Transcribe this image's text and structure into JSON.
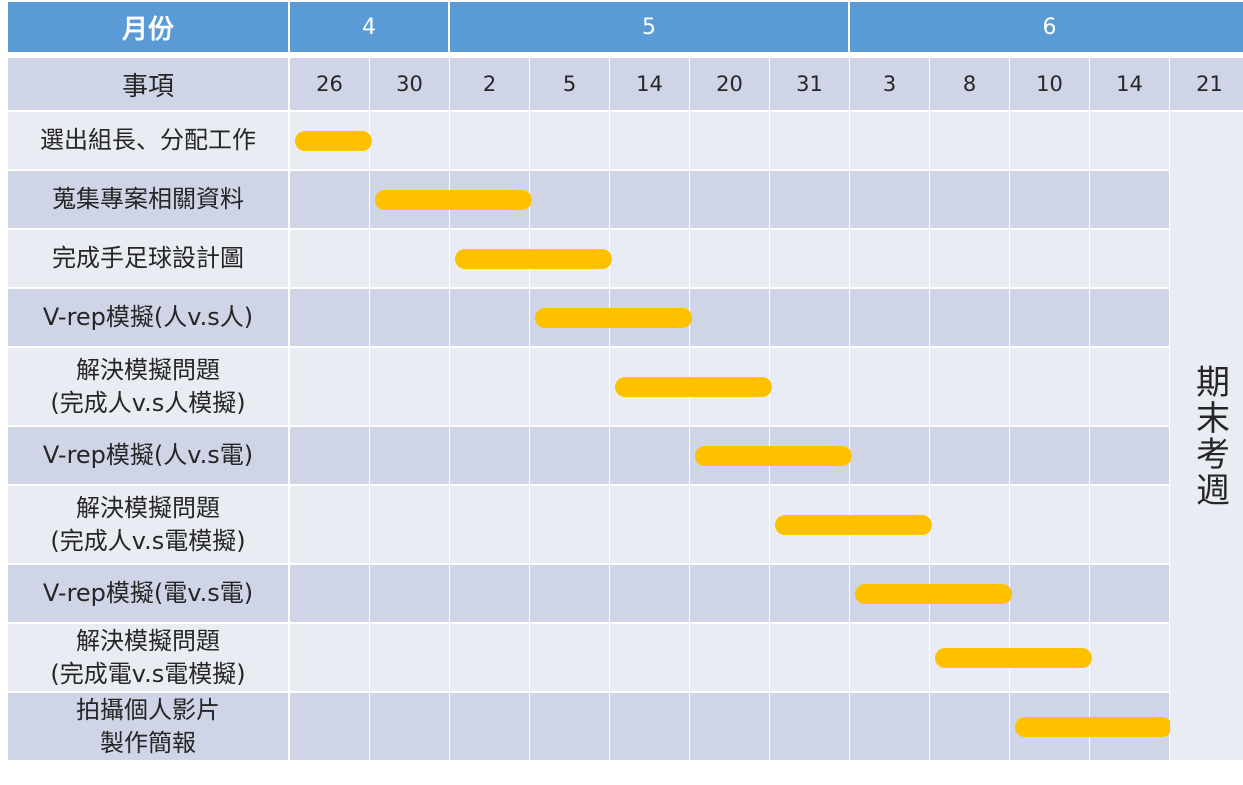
{
  "chart_data": {
    "type": "gantt",
    "header": {
      "month_label": "月份",
      "item_label": "事項",
      "months": [
        "4",
        "5",
        "6"
      ],
      "month_spans": [
        2,
        5,
        5
      ]
    },
    "dates": [
      "26",
      "30",
      "2",
      "5",
      "14",
      "20",
      "31",
      "3",
      "8",
      "10",
      "14",
      "21"
    ],
    "tasks": [
      {
        "label": "選出組長、分配工作",
        "start": "4/26",
        "end": "4/30"
      },
      {
        "label": "蒐集專案相關資料",
        "start": "4/30",
        "end": "5/5"
      },
      {
        "label": "完成手足球設計圖",
        "start": "5/2",
        "end": "5/14"
      },
      {
        "label": "V-rep模擬(人v.s人)",
        "start": "5/5",
        "end": "5/20"
      },
      {
        "label": "解決模擬問題\n(完成人v.s人模擬)",
        "start": "5/14",
        "end": "5/31"
      },
      {
        "label": "V-rep模擬(人v.s電)",
        "start": "5/20",
        "end": "6/3"
      },
      {
        "label": "解決模擬問題\n(完成人v.s電模擬)",
        "start": "5/31",
        "end": "6/8"
      },
      {
        "label": "V-rep模擬(電v.s電)",
        "start": "6/3",
        "end": "6/10"
      },
      {
        "label": "解決模擬問題\n(完成電v.s電模擬)",
        "start": "6/8",
        "end": "6/14"
      },
      {
        "label": "拍攝個人影片\n製作簡報",
        "start": "6/10",
        "end": "6/21"
      }
    ],
    "final_column_label": "期末考週",
    "bar_color": "#ffc000",
    "header_color": "#5b9bd5"
  }
}
